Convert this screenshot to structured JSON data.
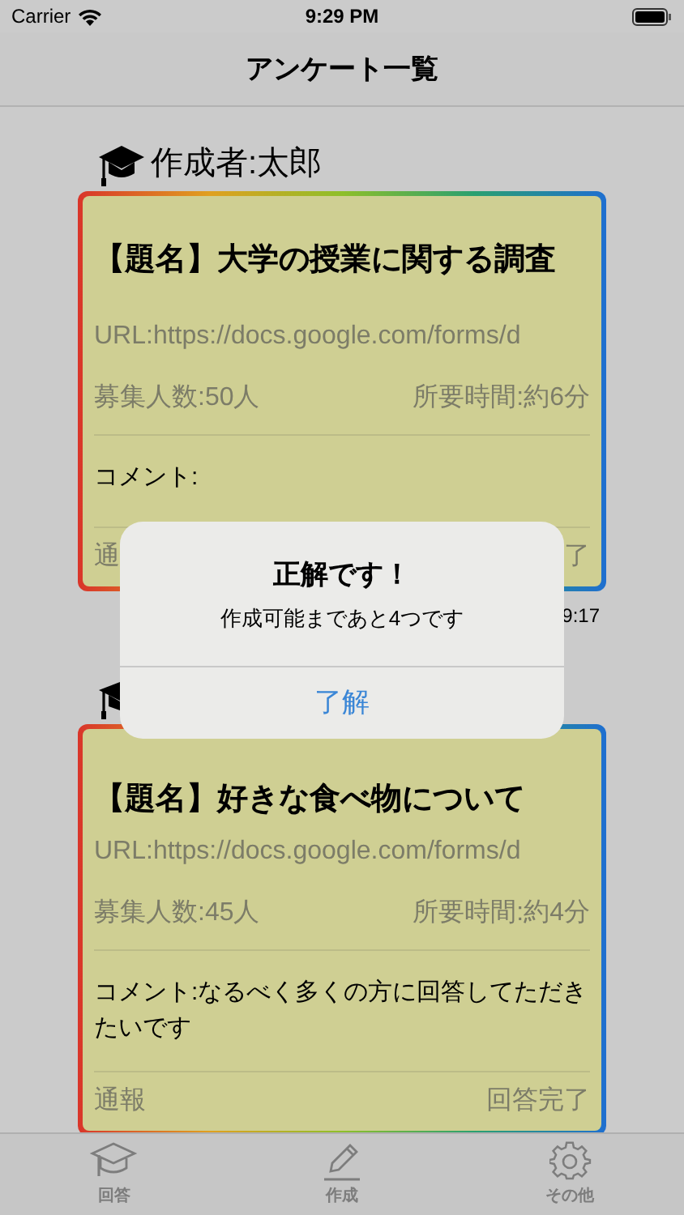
{
  "status_bar": {
    "carrier": "Carrier",
    "time": "9:29 PM"
  },
  "nav_bar": {
    "title": "アンケート一覧"
  },
  "posts": [
    {
      "author": "作成者:太郎",
      "title": "【題名】大学の授業に関する調査",
      "url": "URL:https://docs.google.com/forms/d",
      "recruit": "募集人数:50人",
      "duration": "所要時間:約6分",
      "comment": "コメント:",
      "report": "通",
      "status": "了",
      "posted": "9:17"
    },
    {
      "title": "【題名】好きな食べ物について",
      "url": "URL:https://docs.google.com/forms/d",
      "recruit": "募集人数:45人",
      "duration": "所要時間:約4分",
      "comment": "コメント:なるべく多くの方に回答してただきたいです",
      "report": "通報",
      "status": "回答完了"
    }
  ],
  "alert": {
    "title": "正解です！",
    "message": "作成可能まであと4つです",
    "button": "了解"
  },
  "tab_bar": [
    {
      "kind": "cap",
      "label": "回答"
    },
    {
      "kind": "pencil",
      "label": "作成"
    },
    {
      "kind": "gear",
      "label": "その他"
    }
  ]
}
